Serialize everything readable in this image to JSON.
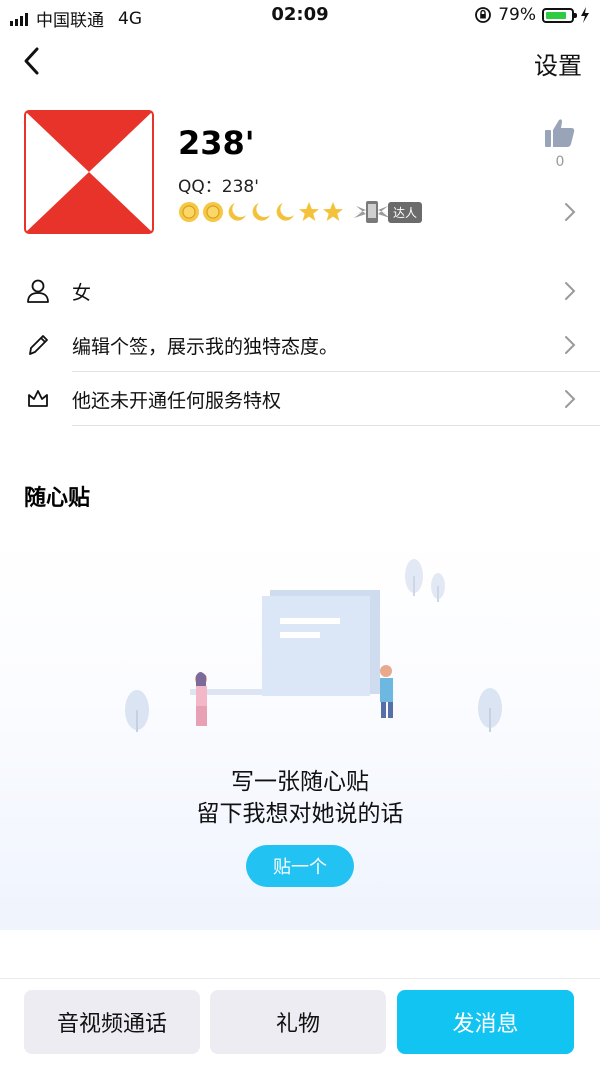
{
  "status_bar": {
    "carrier": "中国联通",
    "network": "4G",
    "time": "02:09",
    "battery": "79%",
    "battery_color": "#2ecc40"
  },
  "nav": {
    "back_icon": "chevron-left-icon",
    "settings_label": "设置"
  },
  "profile": {
    "name": "238'",
    "qq": "QQ：238'",
    "level_icons": [
      "sun",
      "sun",
      "moon",
      "moon",
      "moon",
      "star",
      "star"
    ],
    "badge_label": "达人",
    "like_count": "0"
  },
  "rows": [
    {
      "icon": "person-icon",
      "label": "女"
    },
    {
      "icon": "pencil-icon",
      "label": "编辑个签，展示我的独特态度。"
    },
    {
      "icon": "crown-icon",
      "label": "他还未开通任何服务特权"
    }
  ],
  "post_section": {
    "title": "随心贴",
    "empty_line1": "写一张随心贴",
    "empty_line2": "留下我想对她说的话",
    "button_label": "贴一个"
  },
  "bottom_bar": {
    "call_label": "音视频通话",
    "gift_label": "礼物",
    "message_label": "发消息"
  },
  "colors": {
    "accent": "#12c4f2",
    "avatar_red": "#e8332a",
    "gray_button": "#ececf2"
  }
}
